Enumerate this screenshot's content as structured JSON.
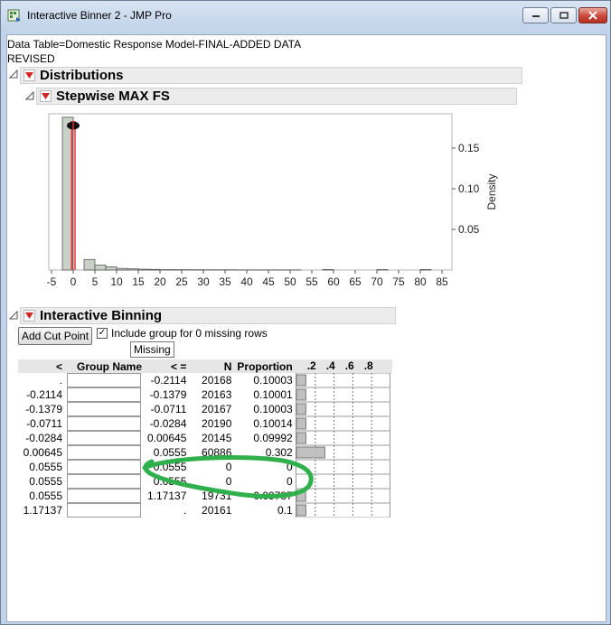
{
  "window": {
    "title": "Interactive Binner 2 - JMP Pro"
  },
  "data_table_line1": "Data Table=Domestic Response Model-FINAL-ADDED DATA",
  "data_table_line2": "REVISED",
  "distributions": {
    "title": "Distributions"
  },
  "stepwise": {
    "title": "Stepwise MAX FS"
  },
  "histogram": {
    "x_ticks": [
      "-5",
      "0",
      "5",
      "10",
      "15",
      "20",
      "25",
      "30",
      "35",
      "40",
      "45",
      "50",
      "55",
      "60",
      "65",
      "70",
      "75",
      "80",
      "85"
    ],
    "y_ticks": [
      "0.15",
      "0.10",
      "0.05"
    ],
    "y_label": "Density"
  },
  "chart_data": {
    "type": "bar",
    "xlabel": "",
    "ylabel": "Density",
    "xlim": [
      -5,
      85
    ],
    "ylim": [
      0,
      0.19
    ],
    "bin_width": 2.5,
    "bins": [
      {
        "x0": -2.5,
        "value": 0.188
      },
      {
        "x0": 2.5,
        "value": 0.013
      },
      {
        "x0": 5,
        "value": 0.006
      },
      {
        "x0": 7.5,
        "value": 0.004
      },
      {
        "x0": 10,
        "value": 0.002
      },
      {
        "x0": 12.5,
        "value": 0.0015
      },
      {
        "x0": 15,
        "value": 0.001
      },
      {
        "x0": 17.5,
        "value": 0.0008
      },
      {
        "x0": 20,
        "value": 0.0005
      },
      {
        "x0": 22.5,
        "value": 0.0005
      },
      {
        "x0": 25,
        "value": 0.0004
      },
      {
        "x0": 27.5,
        "value": 0.0004
      },
      {
        "x0": 30,
        "value": 0.0003
      },
      {
        "x0": 32.5,
        "value": 0.0003
      },
      {
        "x0": 35,
        "value": 0.0003
      },
      {
        "x0": 37.5,
        "value": 0.0002
      },
      {
        "x0": 40,
        "value": 0.0002
      },
      {
        "x0": 42.5,
        "value": 0.0002
      },
      {
        "x0": 45,
        "value": 0.0002
      },
      {
        "x0": 47.5,
        "value": 0.0002
      },
      {
        "x0": 50,
        "value": 0.0002
      },
      {
        "x0": 57.5,
        "value": 0.0006
      },
      {
        "x0": 70,
        "value": 0.0005
      },
      {
        "x0": 80,
        "value": 0.0006
      }
    ],
    "cut_lines": [
      -0.2114,
      -0.1379,
      -0.0711,
      -0.0284,
      0.00645,
      0.0555,
      1.17137
    ]
  },
  "binning": {
    "title": "Interactive Binning",
    "add_cut_label": "Add Cut Point",
    "include_label": "Include group for 0 missing rows",
    "include_checked": true,
    "tooltip": "Missing",
    "headers": [
      "<",
      "Group Name",
      "< =",
      "N",
      "Proportion"
    ],
    "prop_ticks": [
      ".2",
      ".4",
      ".6",
      ".8"
    ],
    "rows": [
      {
        "lt": ".",
        "le": "-0.2114",
        "n": "20168",
        "prop": "0.10003",
        "p": 0.10003
      },
      {
        "lt": "-0.2114",
        "le": "-0.1379",
        "n": "20163",
        "prop": "0.10001",
        "p": 0.10001
      },
      {
        "lt": "-0.1379",
        "le": "-0.0711",
        "n": "20167",
        "prop": "0.10003",
        "p": 0.10003
      },
      {
        "lt": "-0.0711",
        "le": "-0.0284",
        "n": "20190",
        "prop": "0.10014",
        "p": 0.10014
      },
      {
        "lt": "-0.0284",
        "le": "0.00645",
        "n": "20145",
        "prop": "0.09992",
        "p": 0.09992
      },
      {
        "lt": "0.00645",
        "le": "0.0555",
        "n": "60886",
        "prop": "0.302",
        "p": 0.302
      },
      {
        "lt": "0.0555",
        "le": "0.0555",
        "n": "0",
        "prop": "0",
        "p": 0
      },
      {
        "lt": "0.0555",
        "le": "0.0555",
        "n": "0",
        "prop": "0",
        "p": 0
      },
      {
        "lt": "0.0555",
        "le": "1.17137",
        "n": "19731",
        "prop": "0.09787",
        "p": 0.09787
      },
      {
        "lt": "1.17137",
        "le": ".",
        "n": "20161",
        "prop": "0.1",
        "p": 0.1
      }
    ]
  },
  "colors": {
    "bar_fill": "#c8d0c8",
    "cut_line": "#e23c3c",
    "annotation": "#2fb04c"
  }
}
